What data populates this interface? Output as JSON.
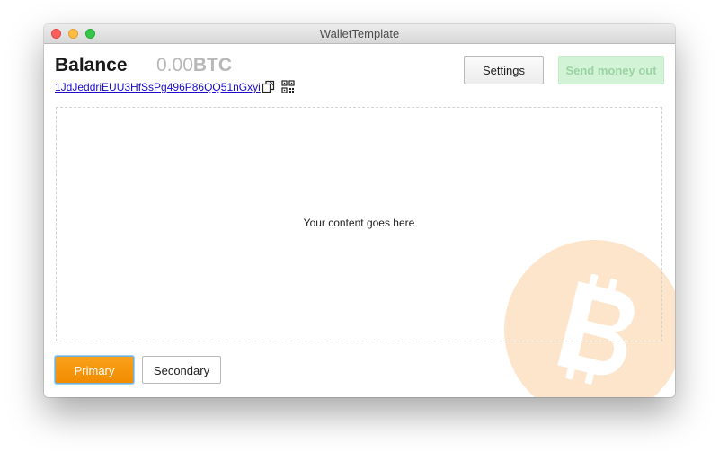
{
  "window": {
    "title": "WalletTemplate"
  },
  "header": {
    "balance_label": "Balance",
    "balance_value": "0.00",
    "balance_unit": "BTC",
    "address": "1JdJeddriEUU3HfSsPg496P86QQ51nGxyi",
    "settings_label": "Settings",
    "send_label": "Send money out"
  },
  "main": {
    "placeholder_text": "Your content goes here"
  },
  "footer": {
    "primary_label": "Primary",
    "secondary_label": "Secondary"
  },
  "icons": {
    "copy": "copy-icon",
    "qr": "qr-code-icon",
    "watermark": "bitcoin-logo-icon"
  },
  "colors": {
    "primary": "#f28c00",
    "send_disabled_bg": "#d2f3d6",
    "link": "#1a0dcc",
    "watermark": "#fde1c4"
  }
}
